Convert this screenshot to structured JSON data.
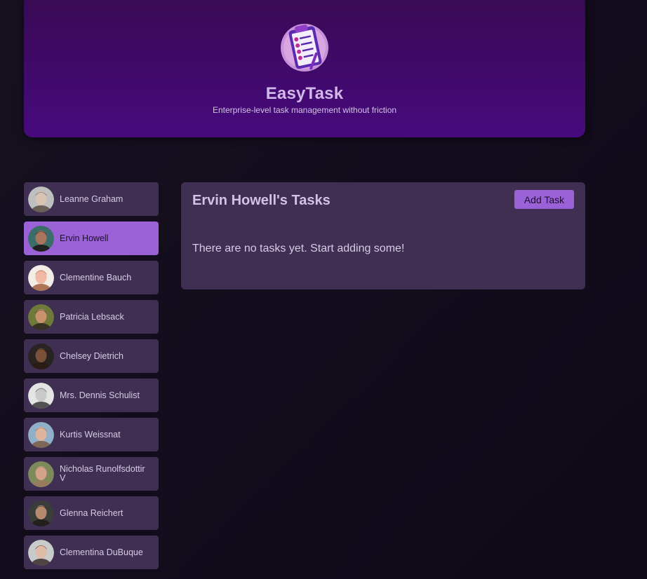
{
  "header": {
    "logo_icon": "clipboard-checklist-icon",
    "title": "EasyTask",
    "subtitle": "Enterprise-level task management without friction"
  },
  "colors": {
    "accent": "#9a62d6",
    "panel": "#3e2f53",
    "header_top": "#390a55",
    "header_bottom": "#470a7e",
    "background": "#120c1c"
  },
  "users": [
    {
      "name": "Leanne Graham",
      "selected": false,
      "avatar": {
        "skin": "#d8c4b4",
        "hair": "#5a4c44",
        "bg": "#bfbfbf"
      }
    },
    {
      "name": "Ervin Howell",
      "selected": true,
      "avatar": {
        "skin": "#a8745e",
        "hair": "#1a1414",
        "bg": "#3b6e68"
      }
    },
    {
      "name": "Clementine Bauch",
      "selected": false,
      "avatar": {
        "skin": "#f0b9a3",
        "hair": "#a0603c",
        "bg": "#f3ebe6"
      }
    },
    {
      "name": "Patricia Lebsack",
      "selected": false,
      "avatar": {
        "skin": "#c8926f",
        "hair": "#2b2420",
        "bg": "#6f7a3a"
      }
    },
    {
      "name": "Chelsey Dietrich",
      "selected": false,
      "avatar": {
        "skin": "#7a5038",
        "hair": "#2a1a12",
        "bg": "#2a2324"
      }
    },
    {
      "name": "Mrs. Dennis Schulist",
      "selected": false,
      "avatar": {
        "skin": "#c9c9c9",
        "hair": "#3a3a3a",
        "bg": "#e4e4e4"
      }
    },
    {
      "name": "Kurtis Weissnat",
      "selected": false,
      "avatar": {
        "skin": "#dfb49c",
        "hair": "#7c5a42",
        "bg": "#8fb0c8"
      }
    },
    {
      "name": "Nicholas Runolfsdottir V",
      "selected": false,
      "avatar": {
        "skin": "#d4a288",
        "hair": "#9a7a60",
        "bg": "#7d8a5a"
      }
    },
    {
      "name": "Glenna Reichert",
      "selected": false,
      "avatar": {
        "skin": "#b58a6e",
        "hair": "#1e1a18",
        "bg": "#3a3d3a"
      }
    },
    {
      "name": "Clementina DuBuque",
      "selected": false,
      "avatar": {
        "skin": "#e0bca8",
        "hair": "#3a2e2a",
        "bg": "#c8cbcc"
      }
    }
  ],
  "tasks": {
    "title": "Ervin Howell's Tasks",
    "add_label": "Add Task",
    "empty_message": "There are no tasks yet. Start adding some!"
  }
}
